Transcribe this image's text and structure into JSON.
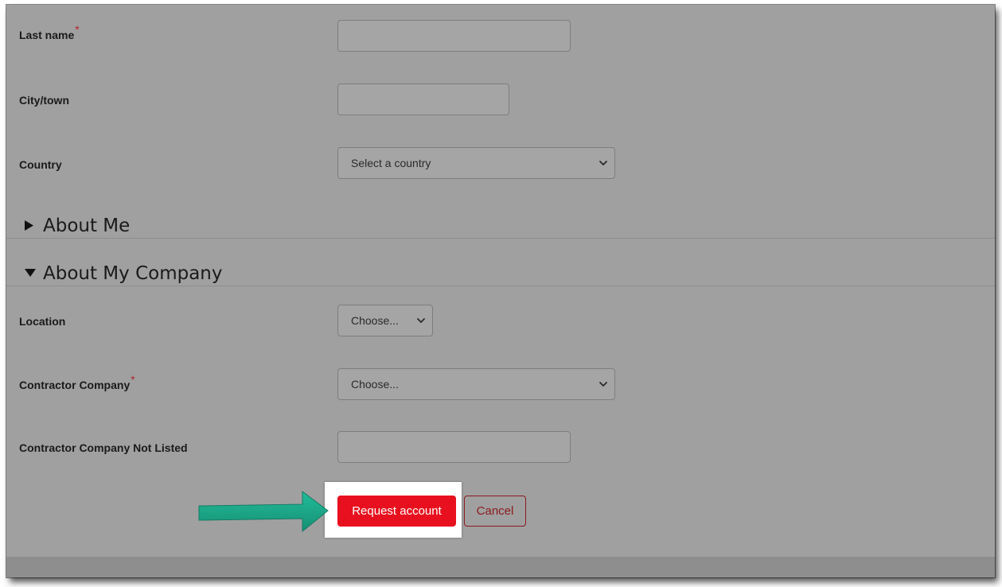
{
  "form": {
    "last_name": {
      "label": "Last name",
      "required_mark": "*",
      "value": ""
    },
    "city": {
      "label": "City/town",
      "value": ""
    },
    "country": {
      "label": "Country",
      "selected": "Select a country"
    },
    "section_about_me": {
      "title": "About Me",
      "expanded": false
    },
    "section_company": {
      "title": "About My Company",
      "expanded": true
    },
    "location": {
      "label": "Location",
      "selected": "Choose..."
    },
    "contractor_company": {
      "label": "Contractor Company",
      "required_mark": "*",
      "selected": "Choose..."
    },
    "contractor_not_listed": {
      "label": "Contractor Company Not Listed",
      "value": ""
    }
  },
  "buttons": {
    "request_label": "Request account",
    "cancel_label": "Cancel"
  },
  "colors": {
    "accent_red": "#e8101e",
    "cancel_border": "#8b1a1f",
    "arrow_green": "#12a586",
    "backdrop_gray": "#a0a0a0"
  },
  "icons": {
    "collapsed": "triangle-right-icon",
    "expanded": "triangle-down-icon",
    "select": "chevron-down-icon",
    "pointer": "arrow-right-icon"
  }
}
